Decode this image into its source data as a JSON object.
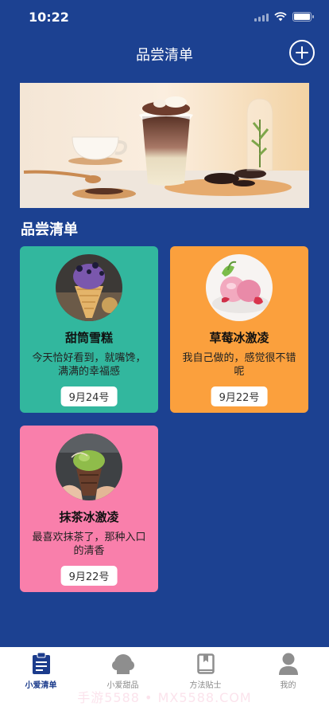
{
  "status_bar": {
    "time": "10:22"
  },
  "nav": {
    "title": "品尝清单"
  },
  "section": {
    "title": "品尝清单"
  },
  "items": [
    {
      "name": "甜筒雪糕",
      "desc": "今天恰好看到，就嘴馋，满满的幸福感",
      "date": "9月24号",
      "color": "#32b79e"
    },
    {
      "name": "草莓冰激凌",
      "desc": "我自己做的，感觉很不错呢",
      "date": "9月22号",
      "color": "#fba03d"
    },
    {
      "name": "抹茶冰激凌",
      "desc": "最喜欢抹茶了，那种入口的清香",
      "date": "9月22号",
      "color": "#f97fab"
    }
  ],
  "tabs": [
    {
      "label": "小爱清单",
      "icon": "clipboard-icon",
      "active": true
    },
    {
      "label": "小爱甜品",
      "icon": "dessert-icon",
      "active": false
    },
    {
      "label": "方法贴士",
      "icon": "book-icon",
      "active": false
    },
    {
      "label": "我的",
      "icon": "user-icon",
      "active": false
    }
  ],
  "watermark": "手游5588 • MX5588.COM",
  "colors": {
    "background": "#1c4191",
    "tab_active": "#1c3c8c",
    "tab_inactive": "#888888"
  }
}
